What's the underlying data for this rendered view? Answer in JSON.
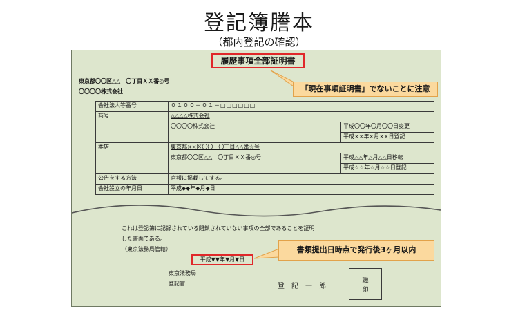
{
  "title": "登記簿謄本",
  "subtitle": "（都内登記の確認）",
  "doc_title": "履歴事項全部証明書",
  "address": "東京都〇〇区△△　〇丁目ＸＸ番◎号",
  "company": "〇〇〇〇株式会社",
  "callout1": "「現在事項証明書」でないことに注意",
  "table": {
    "row1_label": "会社法人等番号",
    "row1_value": "０１００－０１－□□□□□□",
    "row2_label": "商号",
    "row2_value_a": "△△△△株式会社",
    "row2_value_b": "〇〇〇〇株式会社",
    "row2_date_a": "平成〇〇年〇月〇〇日変更",
    "row2_date_b": "平成××年×月××日登記",
    "row3_label": "本店",
    "row3_value_a": "東京都××区〇〇　〇丁目△△番☆号",
    "row3_value_b": "東京都〇〇区△△　〇丁目ＸＸ番◎号",
    "row3_date_a": "平成△△年△月△△日移転",
    "row3_date_b": "平成☆☆年☆月☆☆日登記",
    "row4_label": "公告をする方法",
    "row4_value": "官報に掲載してする。",
    "row5_label": "会社設立の年月日",
    "row5_value": "平成◆◆年◆月◆日"
  },
  "cert_line1": "これは登記簿に記録されている閉鎖されていない事項の全部であることを証明",
  "cert_line2": "した書面である。",
  "bureau_note": "（東京法務局管轄）",
  "cert_date": "平成▼▼年▼月▼日",
  "callout2": "書類提出日時点で発行後3ヶ月以内",
  "office": "東京法務局",
  "registrar_title": "登記官",
  "registrar_name": "登　記　一　郎",
  "seal_line1": "職",
  "seal_line2": "印",
  "colors": {
    "paper": "#dde6cd",
    "highlight_border": "#e0282a",
    "callout_fill": "#fbd99e"
  }
}
